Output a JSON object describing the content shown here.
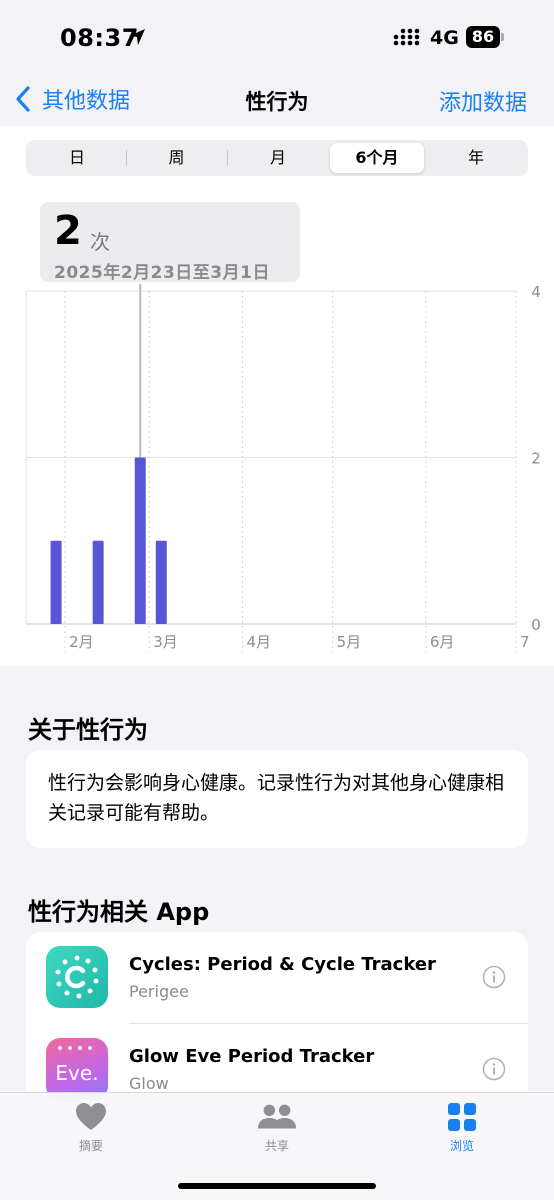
{
  "status": {
    "time": "08:37",
    "network": "4G",
    "battery": "86"
  },
  "nav": {
    "back_label": "其他数据",
    "title": "性行为",
    "add_label": "添加数据"
  },
  "segments": [
    {
      "label": "日",
      "active": false
    },
    {
      "label": "周",
      "active": false
    },
    {
      "label": "月",
      "active": false
    },
    {
      "label": "6个月",
      "active": true
    },
    {
      "label": "年",
      "active": false
    }
  ],
  "tooltip": {
    "value": "2",
    "unit": "次",
    "range": "2025年2月23日至3月1日"
  },
  "chart_data": {
    "type": "bar",
    "title": "",
    "xlabel": "",
    "ylabel": "",
    "x_ticks": [
      "2月",
      "3月",
      "4月",
      "5月",
      "6月",
      "7"
    ],
    "y_ticks": [
      0,
      2,
      4
    ],
    "ylim": [
      0,
      4
    ],
    "series": [
      {
        "values": [
          {
            "week": "2025-01-26",
            "value": 1
          },
          {
            "week": "2025-02-09",
            "value": 1
          },
          {
            "week": "2025-02-23",
            "value": 2
          },
          {
            "week": "2025-03-02",
            "value": 1
          }
        ]
      }
    ],
    "selected_week": "2025-02-23",
    "bar_color": "#5856d6",
    "grid": true
  },
  "about": {
    "title": "关于性行为",
    "text": "性行为会影响身心健康。记录性行为对其他身心健康相关记录可能有帮助。"
  },
  "apps": {
    "title": "性行为相关 App",
    "items": [
      {
        "name": "Cycles: Period & Cycle Tracker",
        "developer": "Perigee",
        "icon": "cycles-app-icon"
      },
      {
        "name": "Glow Eve Period Tracker",
        "developer": "Glow",
        "icon": "eve-app-icon",
        "icon_text": "Eve."
      }
    ]
  },
  "tabbar": [
    {
      "label": "摘要",
      "icon": "heart-icon",
      "active": false
    },
    {
      "label": "共享",
      "icon": "people-icon",
      "active": false
    },
    {
      "label": "浏览",
      "icon": "grid-icon",
      "active": true
    }
  ],
  "colors": {
    "accent": "#1a7ff0",
    "bar": "#5856d6"
  }
}
